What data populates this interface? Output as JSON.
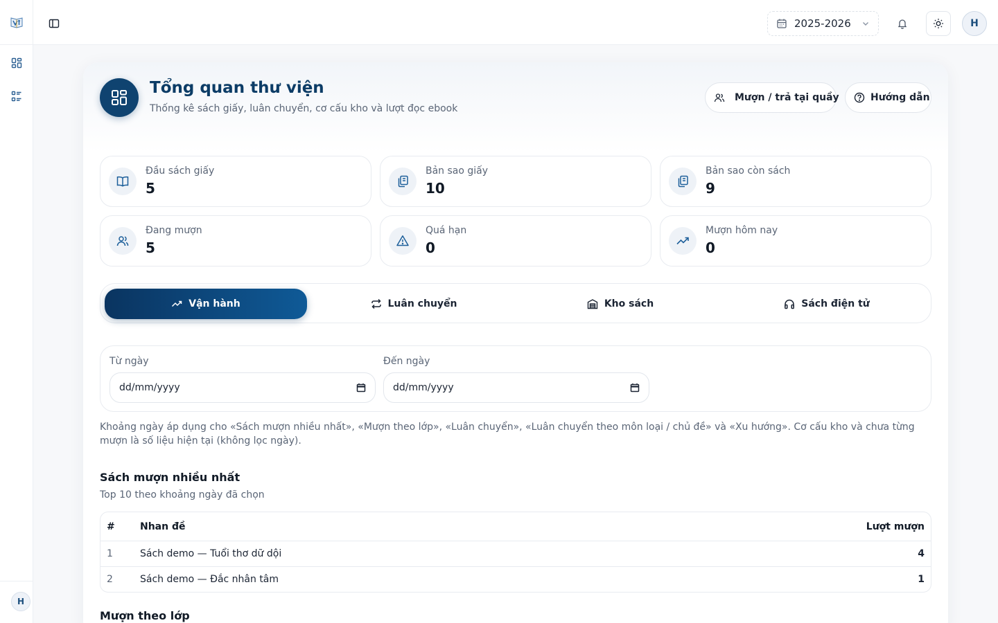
{
  "topbar": {
    "school_year": "2025-2026",
    "user_initial": "H"
  },
  "rail": {
    "user_initial": "H"
  },
  "header": {
    "title": "Tổng quan thư viện",
    "subtitle": "Thống kê sách giấy, luân chuyển, cơ cấu kho và lượt đọc ebook",
    "borrow_button": "Mượn / trả tại quầy",
    "guide_button": "Hướng dẫn"
  },
  "stats": [
    {
      "label": "Đầu sách giấy",
      "value": "5",
      "icon": "book-open-icon"
    },
    {
      "label": "Bản sao giấy",
      "value": "10",
      "icon": "copies-icon"
    },
    {
      "label": "Bản sao còn sách",
      "value": "9",
      "icon": "copies-icon"
    },
    {
      "label": "Đang mượn",
      "value": "5",
      "icon": "users-icon"
    },
    {
      "label": "Quá hạn",
      "value": "0",
      "icon": "warning-icon"
    },
    {
      "label": "Mượn hôm nay",
      "value": "0",
      "icon": "trending-up-icon"
    }
  ],
  "tabs": [
    {
      "label": "Vận hành",
      "active": true
    },
    {
      "label": "Luân chuyển",
      "active": false
    },
    {
      "label": "Kho sách",
      "active": false
    },
    {
      "label": "Sách điện tử",
      "active": false
    }
  ],
  "filters": {
    "from_label": "Từ ngày",
    "from_value": "dd/mm/yyyy",
    "to_label": "Đến ngày",
    "to_value": "dd/mm/yyyy",
    "note": "Khoảng ngày áp dụng cho «Sách mượn nhiều nhất», «Mượn theo lớp», «Luân chuyển», «Luân chuyển theo môn loại / chủ đề» và «Xu hướng». Cơ cấu kho và chưa từng mượn là số liệu hiện tại (không lọc ngày)."
  },
  "top_books": {
    "title": "Sách mượn nhiều nhất",
    "subtitle": "Top 10 theo khoảng ngày đã chọn",
    "columns": [
      "#",
      "Nhan đề",
      "Lượt mượn"
    ],
    "rows": [
      {
        "rank": "1",
        "title": "Sách demo — Tuổi thơ dữ dội",
        "count": "4"
      },
      {
        "rank": "2",
        "title": "Sách demo — Đắc nhân tâm",
        "count": "1"
      }
    ]
  },
  "by_class": {
    "title": "Mượn theo lớp"
  },
  "colors": {
    "primary": "#0c3c66",
    "accent": "#0f5a97"
  }
}
